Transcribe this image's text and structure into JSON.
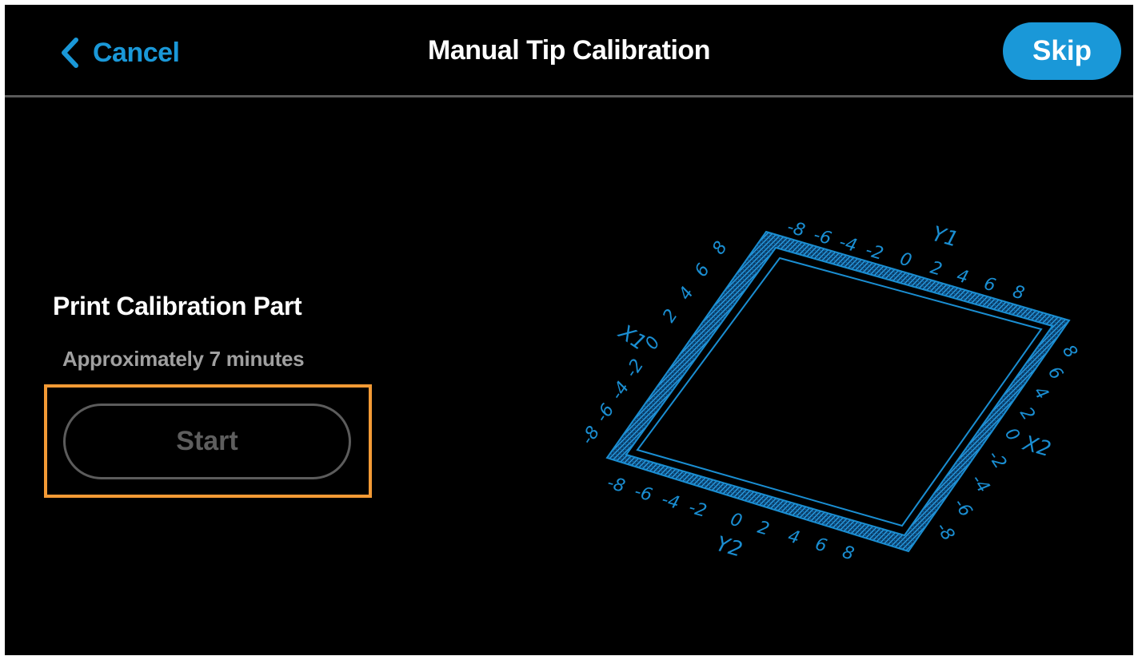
{
  "header": {
    "cancel_label": "Cancel",
    "title": "Manual Tip Calibration",
    "skip_label": "Skip"
  },
  "main": {
    "heading": "Print Calibration Part",
    "duration": "Approximately 7 minutes",
    "start_label": "Start"
  },
  "diagram": {
    "y1_label": "Y1",
    "y2_label": "Y2",
    "x1_label": "X1",
    "x2_label": "X2",
    "top_scale": [
      "-8",
      "-6",
      "-4",
      "-2",
      "0",
      "2",
      "4",
      "6",
      "8"
    ],
    "left_scale": [
      "-8",
      "-6",
      "-4",
      "-2",
      "0",
      "2",
      "4",
      "6",
      "8"
    ],
    "bottom_scale": [
      "-8",
      "-6",
      "-4",
      "-2",
      "0",
      "2",
      "4",
      "6",
      "8"
    ],
    "right_scale": [
      "8",
      "6",
      "4",
      "2",
      "0",
      "-2",
      "-4",
      "-6",
      "-8"
    ]
  },
  "colors": {
    "accent": "#1a98d8",
    "highlight": "#f39a35",
    "disabled": "#5e5e5e",
    "diagram_line": "#1a8ed2"
  },
  "icons": {
    "back": "chevron-left-icon"
  }
}
